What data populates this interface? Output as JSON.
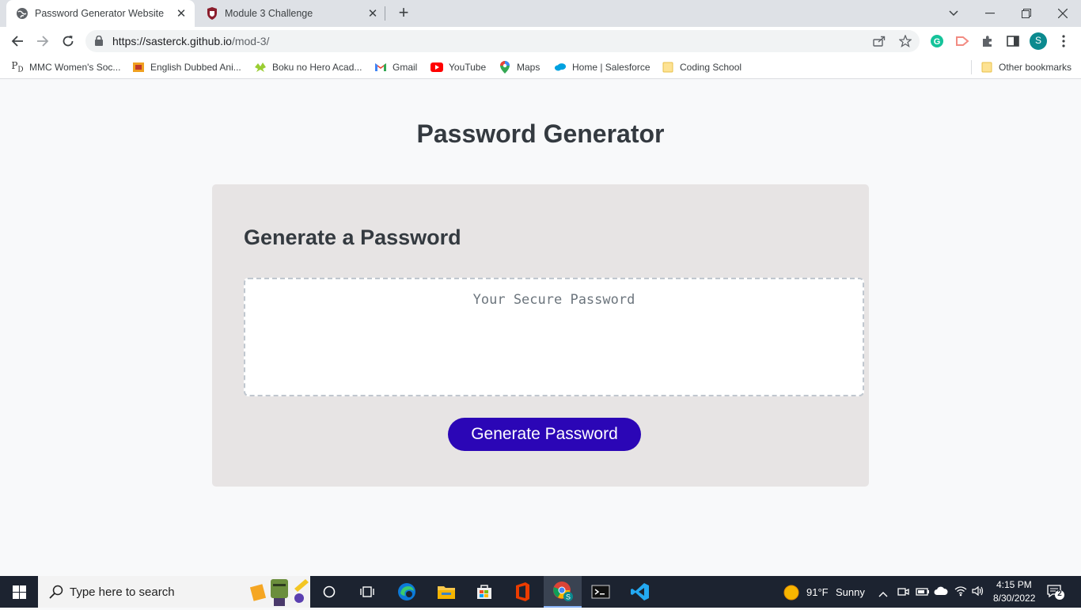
{
  "browser": {
    "tabs": [
      {
        "title": "Password Generator Website",
        "active": true
      },
      {
        "title": "Module 3 Challenge",
        "active": false
      }
    ],
    "url_host": "https://sasterck.github.io",
    "url_path": "/mod-3/",
    "profile_initial": "S",
    "bookmarks": [
      {
        "label": "MMC Women's Soc...",
        "icon": "pd-logo-icon"
      },
      {
        "label": "English Dubbed Ani...",
        "icon": "anime-site-icon"
      },
      {
        "label": "Boku no Hero Acad...",
        "icon": "boku-site-icon"
      },
      {
        "label": "Gmail",
        "icon": "gmail-icon"
      },
      {
        "label": "YouTube",
        "icon": "youtube-icon"
      },
      {
        "label": "Maps",
        "icon": "maps-icon"
      },
      {
        "label": "Home | Salesforce",
        "icon": "salesforce-icon"
      },
      {
        "label": "Coding School",
        "icon": "folder-icon"
      }
    ],
    "other_bookmarks": "Other bookmarks"
  },
  "page": {
    "title": "Password Generator",
    "card_title": "Generate a Password",
    "password_placeholder": "Your Secure Password",
    "generate_button": "Generate Password"
  },
  "taskbar": {
    "search_placeholder": "Type here to search",
    "weather_temp": "91°F",
    "weather_text": "Sunny",
    "time": "4:15 PM",
    "date": "8/30/2022",
    "notification_count": "2"
  },
  "colors": {
    "accent_button": "#2b06b6",
    "card_bg": "#e7e4e4",
    "title_text": "#343a40"
  }
}
